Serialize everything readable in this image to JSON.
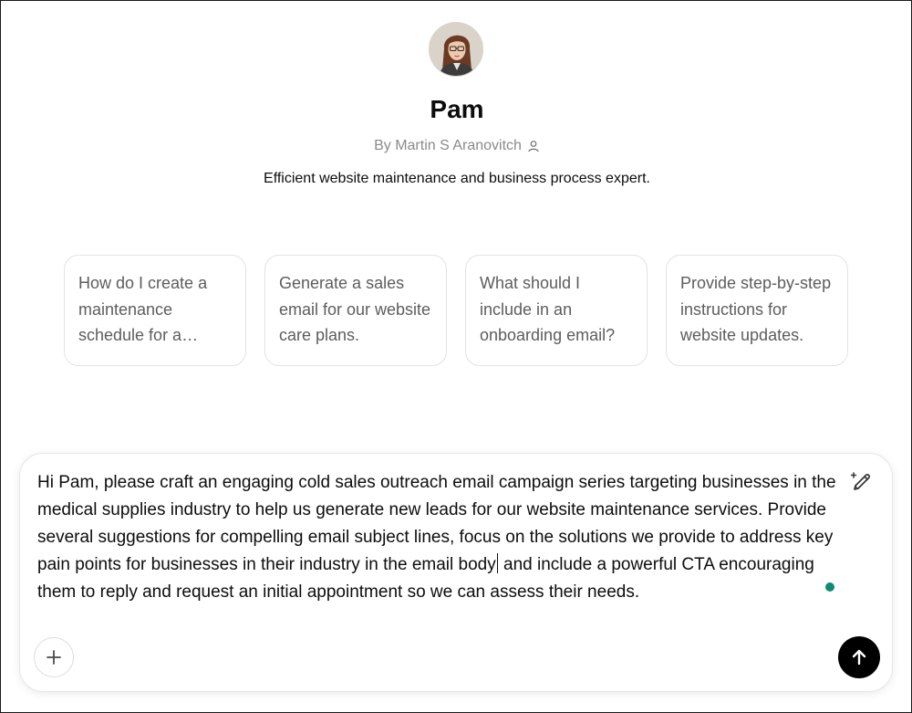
{
  "gpt": {
    "name": "Pam",
    "author": "By Martin S Aranovitch",
    "description": "Efficient website maintenance and business process expert."
  },
  "suggestions": [
    "How do I create a maintenance schedule for a…",
    "Generate a sales email for our website care plans.",
    "What should I include in an onboarding email?",
    "Provide step-by-step instructions for website updates."
  ],
  "composer": {
    "text_before_caret": "Hi Pam, please craft an engaging cold sales outreach email campaign series targeting businesses in the medical supplies industry to help us generate new leads for our website maintenance services. Provide several suggestions for compelling email subject lines, focus on the solutions we provide to address key pain points for businesses in their industry in the email body",
    "text_after_caret": " and include a powerful CTA encouraging them to reply and request an initial appointment so we can assess their needs."
  },
  "icons": {
    "author": "person-icon",
    "magic_edit": "magic-pencil-icon",
    "add": "plus-icon",
    "send": "arrow-up-icon"
  },
  "colors": {
    "status_dot": "#0f8a74",
    "send_button": "#000000"
  }
}
